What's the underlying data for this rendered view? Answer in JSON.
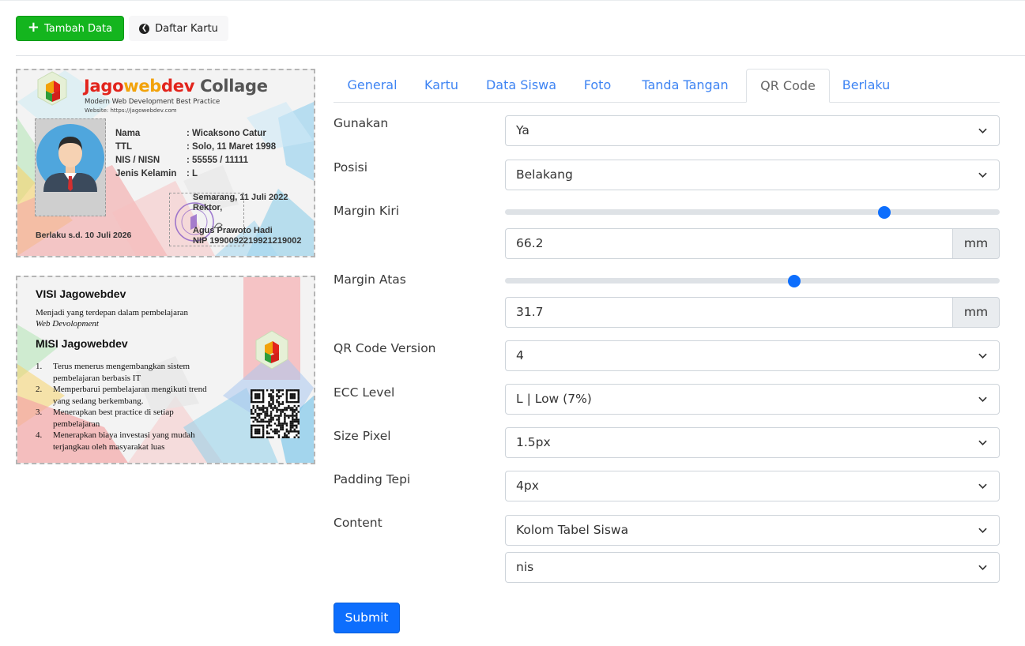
{
  "toolbar": {
    "add_label": "Tambah Data",
    "list_label": "Daftar Kartu",
    "add_icon": "plus-icon",
    "list_icon": "arrow-left-circle-icon"
  },
  "card_front": {
    "logo_part1": "Jago",
    "logo_part2": "web",
    "logo_part3": "dev",
    "logo_part4": " Collage",
    "tagline": "Modern Web Development Best Practice",
    "website": "Website: https://jagowebdev.com",
    "fields": [
      {
        "label": "Nama",
        "value": ": Wicaksono Catur"
      },
      {
        "label": "TTL",
        "value": ": Solo, 11 Maret 1998"
      },
      {
        "label": "NIS / NISN",
        "value": ": 55555 / 11111"
      },
      {
        "label": "Jenis Kelamin",
        "value": ": L"
      }
    ],
    "valid_until": "Berlaku s.d. 10 Juli 2026",
    "sign_place_date": "Semarang, 11 Juli 2022",
    "sign_title": "Rektor,",
    "sign_name": "Agus Prawoto Hadi",
    "sign_nip": "NIP 1990092219921219002"
  },
  "card_back": {
    "visi_title": "VISI Jagowebdev",
    "visi_text1": "Menjadi yang terdepan dalam pembelajaran",
    "visi_text2": "Web Devolopment",
    "misi_title": "MISI Jagowebdev",
    "misi_items": [
      {
        "n": "1.",
        "l1": "Terus menerus mengembangkan sistem",
        "l2": "pembelajaran berbasis IT"
      },
      {
        "n": "2.",
        "l1": "Memperbarui pembelajaran mengikuti trend",
        "l2": "yang sedang berkembang."
      },
      {
        "n": "3.",
        "l1": "Menerapkan best practice di setiap",
        "l2": "pembelajaran"
      },
      {
        "n": "4.",
        "l1": "Menerapkan biaya investasi yang mudah",
        "l2": "terjangkau oleh masyarakat luas"
      }
    ]
  },
  "tabs": [
    "General",
    "Kartu",
    "Data Siswa",
    "Foto",
    "Tanda Tangan",
    "QR Code",
    "Berlaku"
  ],
  "active_tab": "QR Code",
  "form": {
    "gunakan": {
      "label": "Gunakan",
      "value": "Ya"
    },
    "posisi": {
      "label": "Posisi",
      "value": "Belakang"
    },
    "margin_kiri": {
      "label": "Margin Kiri",
      "value": "66.2",
      "unit": "mm",
      "slider_fraction": 0.766
    },
    "margin_atas": {
      "label": "Margin Atas",
      "value": "31.7",
      "unit": "mm",
      "slider_fraction": 0.585
    },
    "qr_version": {
      "label": "QR Code Version",
      "value": "4"
    },
    "ecc_level": {
      "label": "ECC Level",
      "value": "L | Low (7%)"
    },
    "size_pixel": {
      "label": "Size Pixel",
      "value": "1.5px"
    },
    "padding_tepi": {
      "label": "Padding Tepi",
      "value": "4px"
    },
    "content": {
      "label": "Content",
      "value": "Kolom Tabel Siswa",
      "value2": "nis"
    }
  },
  "submit_label": "Submit",
  "colors": {
    "primary": "#0d6efd",
    "success": "#14b51e",
    "tab_link": "#3e84f3"
  }
}
